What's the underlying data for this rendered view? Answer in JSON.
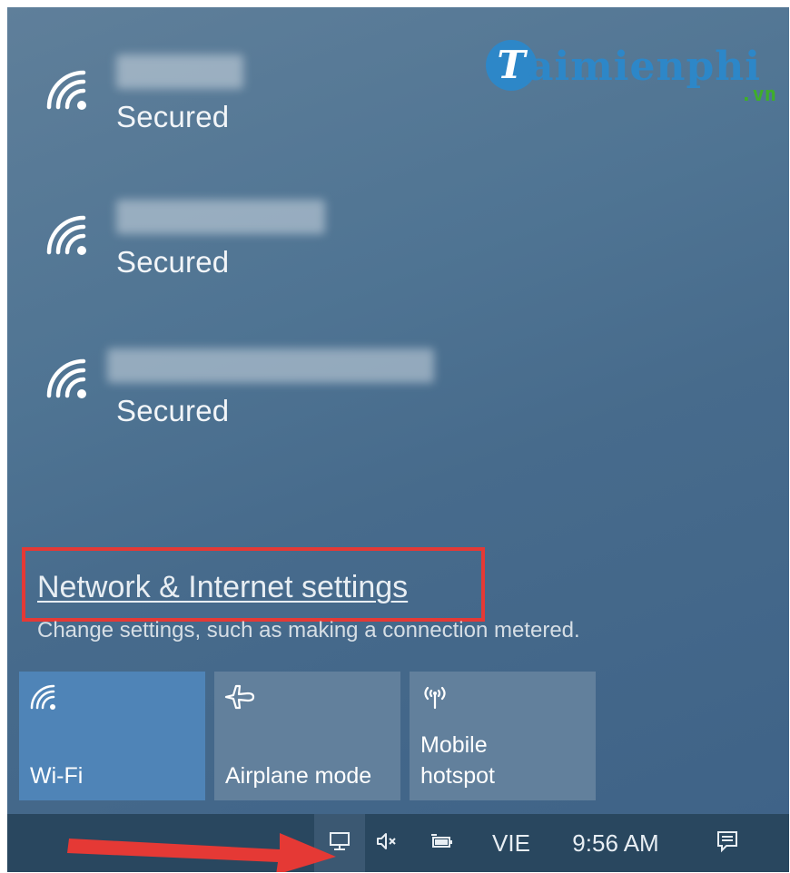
{
  "networks": [
    {
      "status": "Secured",
      "icon": "wifi-signal-icon"
    },
    {
      "status": "Secured",
      "icon": "wifi-signal-icon"
    },
    {
      "status": "Secured",
      "icon": "wifi-signal-icon"
    }
  ],
  "logo": {
    "brand": "aimienphi",
    "letter": "T",
    "tld": ".vn"
  },
  "settings": {
    "link": "Network & Internet settings",
    "description": "Change settings, such as making a connection metered."
  },
  "tiles": [
    {
      "label": "Wi-Fi",
      "icon": "wifi-icon",
      "active": true
    },
    {
      "label": "Airplane mode",
      "icon": "airplane-icon",
      "active": false
    },
    {
      "label": "Mobile\nhotspot",
      "icon": "hotspot-icon",
      "active": false
    }
  ],
  "taskbar": {
    "language": "VIE",
    "time": "9:56 AM"
  },
  "colors": {
    "panel": "#476b8c",
    "tile_active": "#4f84b7",
    "tile_inactive": "#62809c",
    "taskbar": "#29475f",
    "annotation_red": "#e53935"
  }
}
